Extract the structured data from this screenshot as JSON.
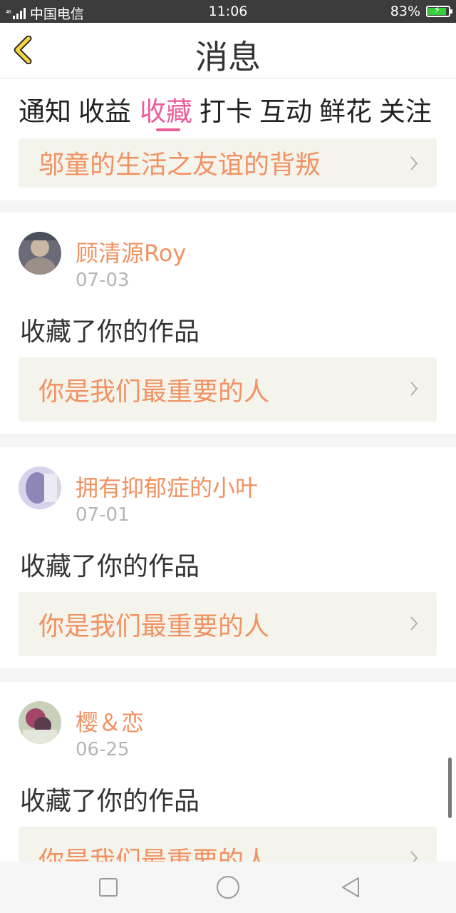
{
  "status_bar": {
    "network": "⁴⁶",
    "carrier": "中国电信",
    "time": "11:06",
    "battery": "83%"
  },
  "header": {
    "title": "消息"
  },
  "tabs": [
    {
      "label": "通知"
    },
    {
      "label": "收益"
    },
    {
      "label": "收藏"
    },
    {
      "label": "打卡"
    },
    {
      "label": "互动"
    },
    {
      "label": "鲜花"
    },
    {
      "label": "关注"
    }
  ],
  "active_tab": "收藏",
  "items": [
    {
      "work_title": "邬童的生活之友谊的背叛"
    },
    {
      "user": "顾清源Roy",
      "date": "07-03",
      "action": "收藏了你的作品",
      "work_title": "你是我们最重要的人"
    },
    {
      "user": "拥有抑郁症的小叶",
      "date": "07-01",
      "action": "收藏了你的作品",
      "work_title": "你是我们最重要的人"
    },
    {
      "user": "樱＆恋",
      "date": "06-25",
      "action": "收藏了你的作品",
      "work_title": "你是我们最重要的人"
    }
  ],
  "colors": {
    "accent": "#ee5c9b",
    "username": "#f19262",
    "battery": "#35d13d"
  }
}
